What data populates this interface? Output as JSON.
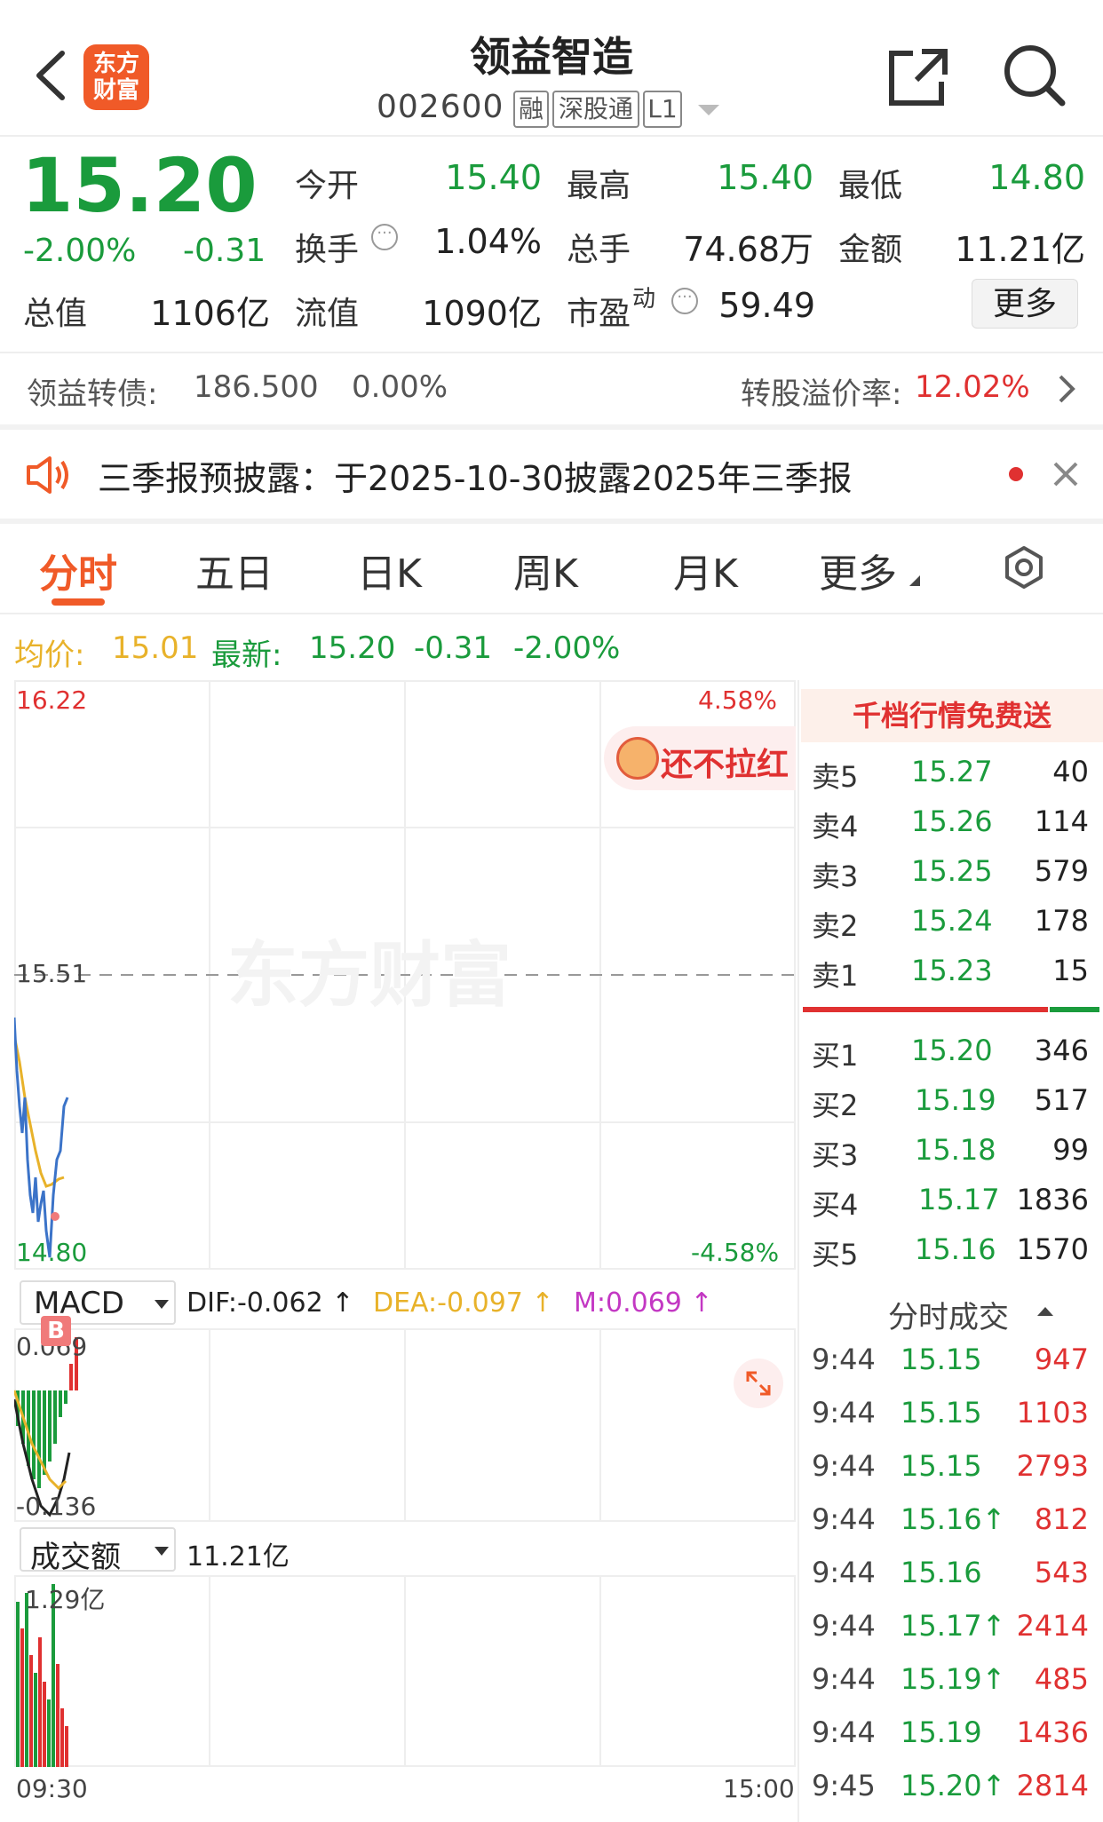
{
  "header": {
    "title": "领益智造",
    "code": "002600",
    "tags": [
      "融",
      "深股通",
      "L1"
    ],
    "logo_line1": "东方",
    "logo_line2": "财富"
  },
  "quote": {
    "price": "15.20",
    "change_pct": "-2.00%",
    "change": "-0.31",
    "open_label": "今开",
    "open": "15.40",
    "high_label": "最高",
    "high": "15.40",
    "low_label": "最低",
    "low": "14.80",
    "turnover_label": "换手",
    "turnover": "1.04%",
    "volume_label": "总手",
    "volume": "74.68万",
    "amount_label": "金额",
    "amount": "11.21亿",
    "mktcap_label": "总值",
    "mktcap": "1106亿",
    "float_label": "流值",
    "float": "1090亿",
    "pe_label": "市盈",
    "pe_sup": "动",
    "pe": "59.49",
    "more": "更多"
  },
  "bond": {
    "label": "领益转债:",
    "price": "186.500",
    "pct": "0.00%",
    "premium_label": "转股溢价率:",
    "premium": "12.02%"
  },
  "notice": {
    "text": "三季报预披露：于2025-10-30披露2025年三季报"
  },
  "tabs": [
    "分时",
    "五日",
    "日K",
    "周K",
    "月K",
    "更多"
  ],
  "avg_line": {
    "avg_label": "均价:",
    "avg": "15.01",
    "latest_label": "最新:",
    "latest": "15.20",
    "change": "-0.31",
    "pct": "-2.00%"
  },
  "chart": {
    "y_top": "16.22",
    "y_mid": "15.51",
    "y_bot": "14.80",
    "pct_top": "4.58%",
    "pct_bot": "-4.58%",
    "promo": "还不拉红",
    "watermark": "东方财富",
    "time_start": "09:30",
    "time_end": "15:00"
  },
  "macd": {
    "name": "MACD",
    "dif": "DIF:-0.062 ↑",
    "dea": "DEA:-0.097 ↑",
    "m": "M:0.069 ↑",
    "top": "0.069",
    "bot": "-0.136",
    "b_marker": "B"
  },
  "vol": {
    "name": "成交额",
    "total": "11.21亿",
    "top": "1.29亿"
  },
  "orderbook": {
    "banner": "千档行情免费送",
    "asks": [
      {
        "label": "卖5",
        "price": "15.27",
        "qty": "40"
      },
      {
        "label": "卖4",
        "price": "15.26",
        "qty": "114"
      },
      {
        "label": "卖3",
        "price": "15.25",
        "qty": "579"
      },
      {
        "label": "卖2",
        "price": "15.24",
        "qty": "178"
      },
      {
        "label": "卖1",
        "price": "15.23",
        "qty": "15"
      }
    ],
    "bids": [
      {
        "label": "买1",
        "price": "15.20",
        "qty": "346"
      },
      {
        "label": "买2",
        "price": "15.19",
        "qty": "517"
      },
      {
        "label": "买3",
        "price": "15.18",
        "qty": "99"
      },
      {
        "label": "买4",
        "price": "15.17",
        "qty": "1836"
      },
      {
        "label": "买5",
        "price": "15.16",
        "qty": "1570"
      }
    ]
  },
  "trades": {
    "title": "分时成交",
    "rows": [
      {
        "time": "9:44",
        "price": "15.15",
        "qty": "947"
      },
      {
        "time": "9:44",
        "price": "15.15",
        "qty": "1103"
      },
      {
        "time": "9:44",
        "price": "15.15",
        "qty": "2793"
      },
      {
        "time": "9:44",
        "price": "15.16↑",
        "qty": "812"
      },
      {
        "time": "9:44",
        "price": "15.16",
        "qty": "543"
      },
      {
        "time": "9:44",
        "price": "15.17↑",
        "qty": "2414"
      },
      {
        "time": "9:44",
        "price": "15.19↑",
        "qty": "485"
      },
      {
        "time": "9:44",
        "price": "15.19",
        "qty": "1436"
      },
      {
        "time": "9:45",
        "price": "15.20↑",
        "qty": "2814"
      }
    ]
  },
  "colors": {
    "up": "#e03131",
    "down": "#1a9b3c",
    "avg": "#e8b22a",
    "price_line": "#3b73c8",
    "brand": "#f05a28"
  }
}
